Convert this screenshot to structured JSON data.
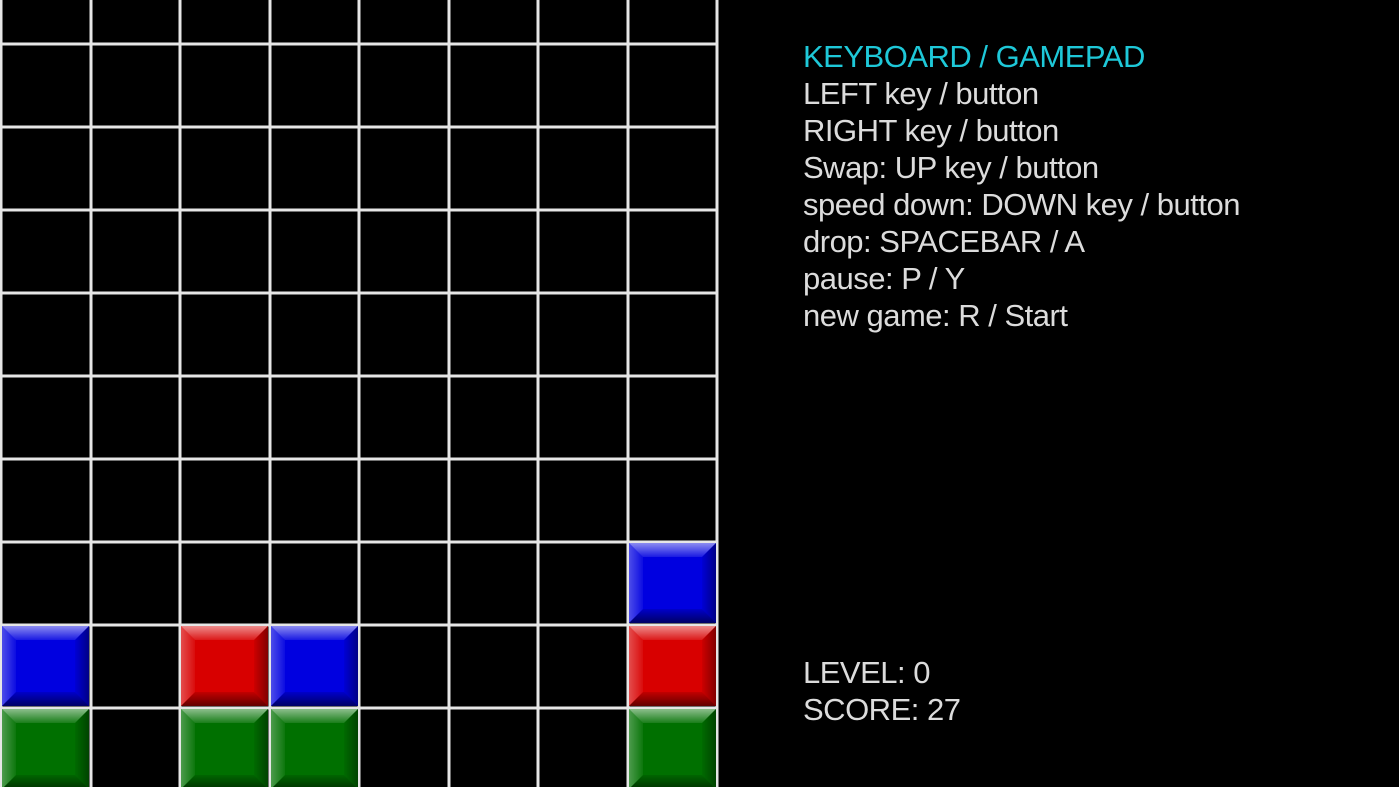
{
  "controls": {
    "heading": "KEYBOARD / GAMEPAD",
    "lines": [
      "LEFT key / button",
      "RIGHT key / button",
      "Swap: UP key / button",
      "speed down: DOWN key / button",
      "drop: SPACEBAR / A",
      "pause: P / Y",
      "new game: R / Start"
    ]
  },
  "stats": {
    "level_label": "LEVEL:",
    "level_value": "0",
    "score_label": "SCORE:",
    "score_value": "27"
  },
  "colors": {
    "heading": "#1ec8d8",
    "text": "#dcdcdc",
    "grid": "#e6e6e6",
    "background": "#000000",
    "block_red": "#d80000",
    "block_blue": "#0000e0",
    "block_green": "#007000"
  },
  "board": {
    "columns": 8,
    "rows": 9,
    "cells": [
      {
        "col": 7,
        "row": 6,
        "color": "blue"
      },
      {
        "col": 0,
        "row": 7,
        "color": "blue"
      },
      {
        "col": 2,
        "row": 7,
        "color": "red"
      },
      {
        "col": 3,
        "row": 7,
        "color": "blue"
      },
      {
        "col": 7,
        "row": 7,
        "color": "red"
      },
      {
        "col": 0,
        "row": 8,
        "color": "green"
      },
      {
        "col": 2,
        "row": 8,
        "color": "green"
      },
      {
        "col": 3,
        "row": 8,
        "color": "green"
      },
      {
        "col": 7,
        "row": 8,
        "color": "green"
      }
    ]
  }
}
